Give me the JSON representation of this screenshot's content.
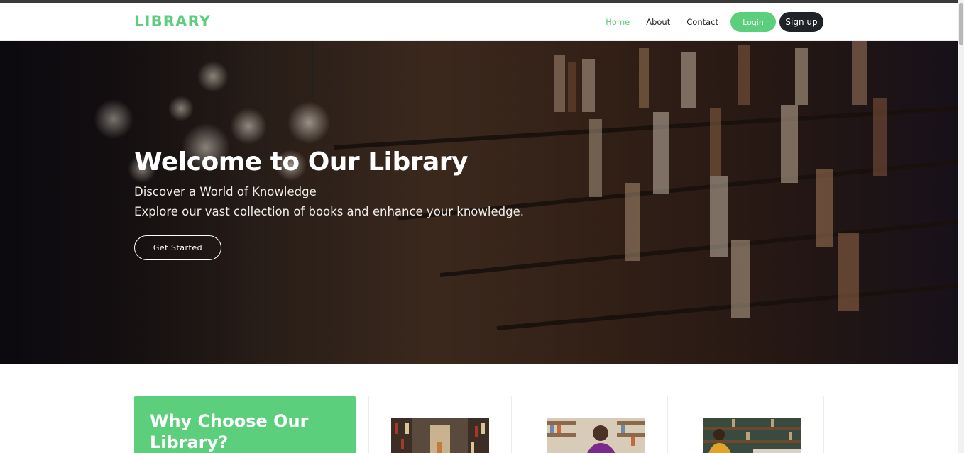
{
  "navbar": {
    "brand": "LIBRARY",
    "links": [
      {
        "label": "Home",
        "active": true
      },
      {
        "label": "About",
        "active": false
      },
      {
        "label": "Contact",
        "active": false
      }
    ],
    "login_label": "Login",
    "signup_label": "Sign up"
  },
  "hero": {
    "title": "Welcome to Our Library",
    "subtitle": "Discover a World of Knowledge",
    "description": "Explore our vast collection of books and enhance your knowledge.",
    "cta_label": "Get Started"
  },
  "why": {
    "title": "Why Choose Our Library?"
  },
  "colors": {
    "accent": "#5ccf7c",
    "dark_button": "#1f2328"
  }
}
